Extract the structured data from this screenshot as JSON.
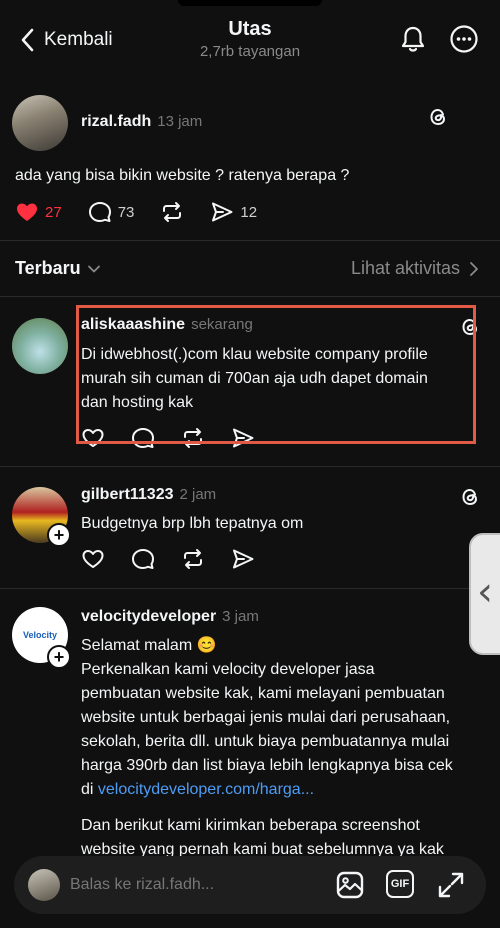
{
  "header": {
    "back_label": "Kembali",
    "title": "Utas",
    "subtitle": "2,7rb tayangan"
  },
  "main_post": {
    "username": "rizal.fadh",
    "time": "13 jam",
    "text": "ada yang bisa bikin website ? ratenya berapa ?",
    "likes": "27",
    "replies": "73",
    "shares": "12"
  },
  "sort": {
    "label": "Terbaru",
    "activity_label": "Lihat aktivitas"
  },
  "replies": [
    {
      "username": "aliskaaashine",
      "time": "sekarang",
      "lines": [
        "Di idwebhost(.)com klau website company profile",
        "murah sih cuman di 700an aja udh dapet domain",
        "dan hosting kak"
      ]
    },
    {
      "username": "gilbert11323",
      "time": "2 jam",
      "lines": [
        "Budgetnya brp lbh tepatnya om"
      ]
    },
    {
      "username": "velocitydeveloper",
      "time": "3 jam",
      "logo_text": "Velocity",
      "lines": [
        "Selamat malam 😊",
        "Perkenalkan kami velocity developer jasa",
        "pembuatan website kak, kami melayani pembuatan",
        "website untuk berbagai jenis mulai dari perusahaan,",
        "sekolah, berita dll. untuk biaya pembuatannya mulai",
        "harga 390rb dan list biaya lebih lengkapnya bisa cek"
      ],
      "link_prefix": "di ",
      "link_text": "velocitydeveloper.com/harga...",
      "lines_after": [
        "Dan berikut kami kirimkan beberapa screenshot",
        "website yang pernah kami buat sebelumnya ya kak"
      ]
    }
  ],
  "reply_bar": {
    "placeholder": "Balas ke rizal.fadh...",
    "gif_label": "GIF"
  },
  "colors": {
    "background": "#101010",
    "like_red": "#ff3040",
    "link_blue": "#4f9cf5",
    "highlight_border": "#e05a45"
  }
}
